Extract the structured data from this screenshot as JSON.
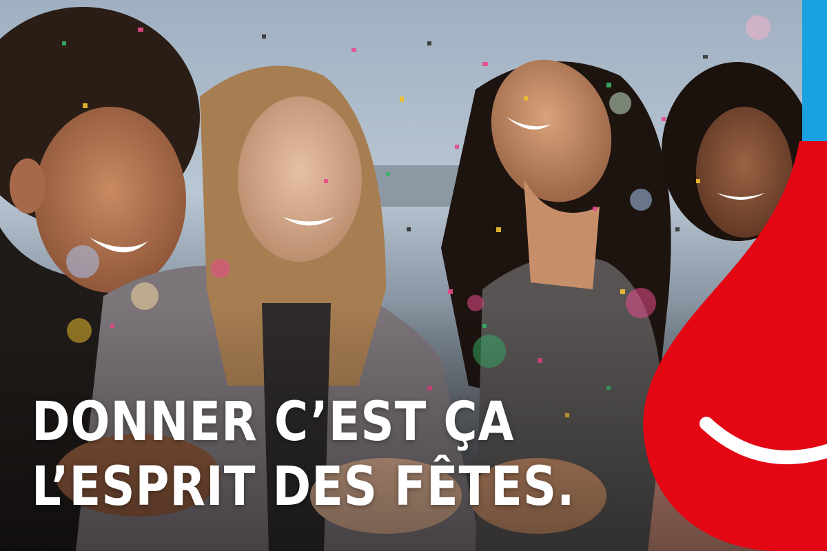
{
  "headline": {
    "line1": "DONNER C’EST ÇA",
    "line2": "L’ESPRIT DES FÊTES."
  },
  "colors": {
    "drop_red": "#e30613",
    "strip_blue": "#1aa2e0",
    "headline_white": "#ffffff",
    "sky": "#b9c6d3"
  },
  "icons": {
    "drop": "blood-drop-smile-icon"
  }
}
